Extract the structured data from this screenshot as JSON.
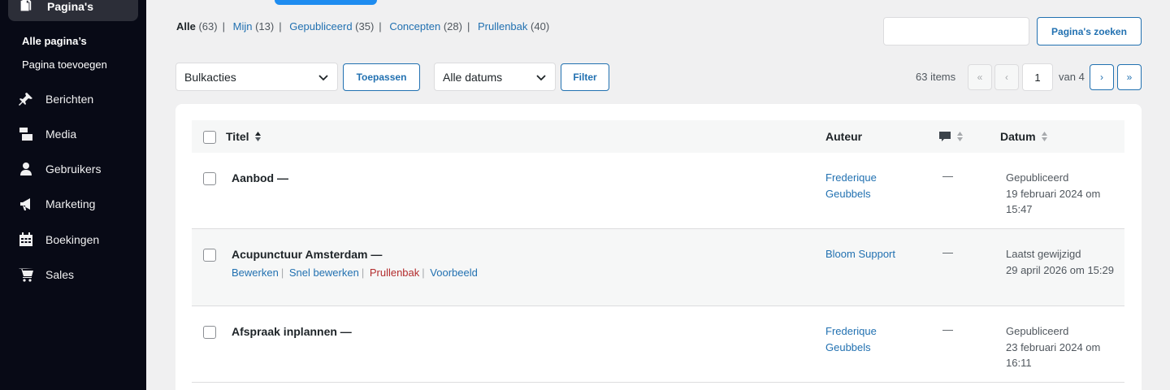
{
  "sidebar": {
    "current": "Pagina's",
    "sub": [
      "Alle pagina’s",
      "Pagina toevoegen"
    ],
    "items": [
      {
        "label": "Berichten",
        "icon": "pin-icon"
      },
      {
        "label": "Media",
        "icon": "media-icon"
      },
      {
        "label": "Gebruikers",
        "icon": "user-icon"
      },
      {
        "label": "Marketing",
        "icon": "megaphone-icon"
      },
      {
        "label": "Boekingen",
        "icon": "calendar-icon"
      },
      {
        "label": "Sales",
        "icon": "cart-icon"
      }
    ]
  },
  "filters": {
    "all": {
      "label": "Alle",
      "count": "(63)"
    },
    "mine": {
      "label": "Mijn",
      "count": "(13)"
    },
    "published": {
      "label": "Gepubliceerd",
      "count": "(35)"
    },
    "drafts": {
      "label": "Concepten",
      "count": "(28)"
    },
    "trash": {
      "label": "Prullenbak",
      "count": "(40)"
    }
  },
  "search": {
    "value": "",
    "button": "Pagina's zoeken"
  },
  "toolbar": {
    "bulk": "Bulkacties",
    "apply": "Toepassen",
    "dates": "Alle datums",
    "filter": "Filter",
    "items": "63 items",
    "page": "1",
    "of": "van 4",
    "first": "«",
    "prev": "‹",
    "next": "›",
    "last": "»"
  },
  "table": {
    "headers": {
      "title": "Titel",
      "author": "Auteur",
      "date": "Datum"
    },
    "rows": [
      {
        "title": "Aanbod —",
        "author": "Frederique Geubbels",
        "comments": "—",
        "status": "Gepubliceerd",
        "date": "19 februari 2024 om 15:47"
      },
      {
        "title": "Acupunctuur Amsterdam —",
        "author": "Bloom Support",
        "comments": "—",
        "status": "Laatst gewijzigd",
        "date": "29 april 2026 om 15:29",
        "actions": {
          "edit": "Bewerken",
          "quick": "Snel bewerken",
          "trash": "Prullenbak",
          "view": "Voorbeeld"
        }
      },
      {
        "title": "Afspraak inplannen —",
        "author": "Frederique Geubbels",
        "comments": "—",
        "status": "Gepubliceerd",
        "date": "23 februari 2024 om 16:11"
      }
    ]
  }
}
